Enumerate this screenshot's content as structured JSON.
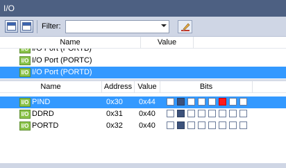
{
  "window": {
    "title": "I/O"
  },
  "toolbar": {
    "filter_label": "Filter:",
    "filter_value": "",
    "filter_placeholder": ""
  },
  "ports_panel": {
    "columns": {
      "name": "Name",
      "value": "Value"
    },
    "items": [
      {
        "icon": "I/O",
        "label": "I/O Port (PORTB)",
        "selected": false
      },
      {
        "icon": "I/O",
        "label": "I/O Port (PORTC)",
        "selected": false
      },
      {
        "icon": "I/O",
        "label": "I/O Port (PORTD)",
        "selected": true
      }
    ]
  },
  "registers_panel": {
    "columns": {
      "name": "Name",
      "address": "Address",
      "value": "Value",
      "bits": "Bits"
    },
    "rows": [
      {
        "icon": "I/O",
        "name": "PIND",
        "address": "0x30",
        "value": "0x44",
        "bits": [
          0,
          1,
          0,
          0,
          0,
          1,
          0,
          0
        ],
        "highlight_bit": 5,
        "selected": true
      },
      {
        "icon": "I/O",
        "name": "DDRD",
        "address": "0x31",
        "value": "0x40",
        "bits": [
          0,
          1,
          0,
          0,
          0,
          0,
          0,
          0
        ],
        "highlight_bit": null,
        "selected": false
      },
      {
        "icon": "I/O",
        "name": "PORTD",
        "address": "0x32",
        "value": "0x40",
        "bits": [
          0,
          1,
          0,
          0,
          0,
          0,
          0,
          0
        ],
        "highlight_bit": null,
        "selected": false
      }
    ]
  },
  "colors": {
    "titlebar": "#4d6082",
    "selection": "#3399ff",
    "bit_on": "#3c527c",
    "bit_changed": "#ff1a1a",
    "io_icon": "#8bc34a"
  }
}
